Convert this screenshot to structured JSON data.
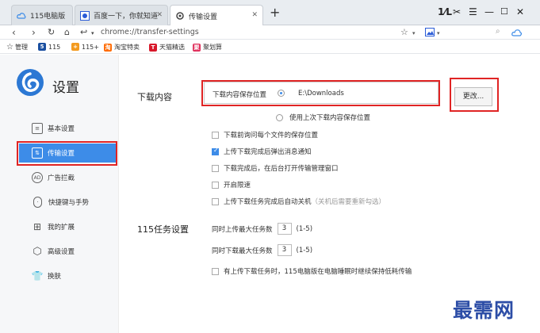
{
  "tabs": [
    {
      "label": "115电脑版",
      "icon": "cloud-icon",
      "active": false
    },
    {
      "label": "百度一下，你就知道",
      "icon": "baidu-icon",
      "active": false
    },
    {
      "label": "传输设置",
      "icon": "gear-icon",
      "active": true
    }
  ],
  "window_controls": {
    "ai_icon": "1⁄L",
    "scissors": "✂",
    "menu": "☰",
    "minimize": "—",
    "maximize": "☐",
    "close": "✕"
  },
  "address": {
    "url": "chrome://transfer-settings"
  },
  "bookmarks": [
    {
      "label": "管理",
      "icon": "star-icon",
      "color": "#444444"
    },
    {
      "label": "115",
      "icon": "115-icon",
      "color": "#1a4fa0"
    },
    {
      "label": "115+",
      "icon": "115plus-icon",
      "color": "#f39a1e"
    },
    {
      "label": "淘宝特卖",
      "icon": "taobao-icon",
      "color": "#ff6a00"
    },
    {
      "label": "天猫精选",
      "icon": "tmall-icon",
      "color": "#d8182a"
    },
    {
      "label": "聚划算",
      "icon": "juhuasuan-icon",
      "color": "#e0305c"
    }
  ],
  "sidebar": {
    "title": "设置",
    "items": [
      {
        "label": "基本设置",
        "icon": "sliders-icon",
        "active": false
      },
      {
        "label": "传输设置",
        "icon": "transfer-icon",
        "active": true
      },
      {
        "label": "广告拦截",
        "icon": "ad-block-icon",
        "active": false
      },
      {
        "label": "快捷键与手势",
        "icon": "mouse-icon",
        "active": false
      },
      {
        "label": "我的扩展",
        "icon": "extensions-icon",
        "active": false
      },
      {
        "label": "高级设置",
        "icon": "hexagon-gear-icon",
        "active": false
      },
      {
        "label": "换肤",
        "icon": "shirt-icon",
        "active": false
      }
    ]
  },
  "download": {
    "section_title": "下载内容",
    "save_location_label": "下载内容保存位置",
    "save_location_value": "E:\\Downloads",
    "change_button": "更改...",
    "use_last_label": "使用上次下载内容保存位置",
    "options": [
      {
        "label": "下载前询问每个文件的保存位置",
        "checked": false,
        "hint": ""
      },
      {
        "label": "上传下载完成后弹出消息通知",
        "checked": true,
        "hint": ""
      },
      {
        "label": "下载完成后，在后台打开传输管理窗口",
        "checked": false,
        "hint": ""
      },
      {
        "label": "开启限速",
        "checked": false,
        "hint": ""
      },
      {
        "label": "上传下载任务完成后自动关机",
        "checked": false,
        "hint": "（关机后需要重新勾选）"
      }
    ]
  },
  "tasks115": {
    "section_title": "115任务设置",
    "upload_label": "同时上传最大任务数",
    "upload_value": "3",
    "upload_range": "(1-5)",
    "download_label": "同时下载最大任务数",
    "download_value": "3",
    "download_range": "(1-5)",
    "keep_alive_label": "有上传下载任务时，115电脑版在电脑睡眠时继续保持低耗传输",
    "keep_alive_checked": false
  },
  "watermark": "最需网",
  "colors": {
    "accent": "#3d8ce8",
    "annotation_red": "#e02424"
  }
}
